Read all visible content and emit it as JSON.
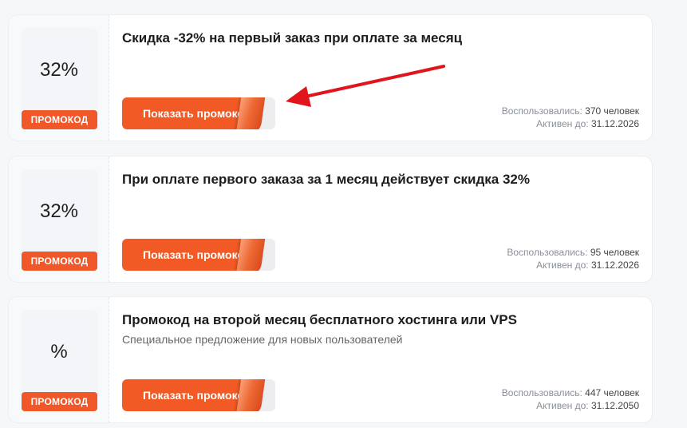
{
  "promos": [
    {
      "discount": "32%",
      "badge": "ПРОМОКОД",
      "title": "Скидка -32% на первый заказ при оплате за месяц",
      "subtitle": "",
      "button_label": "Показать промокод",
      "used_label": "Воспользовались:",
      "used_value": "370 человек",
      "active_label": "Активен до:",
      "active_value": "31.12.2026"
    },
    {
      "discount": "32%",
      "badge": "ПРОМОКОД",
      "title": "При оплате первого заказа за 1 месяц действует скидка 32%",
      "subtitle": "",
      "button_label": "Показать промокод",
      "used_label": "Воспользовались:",
      "used_value": "95 человек",
      "active_label": "Активен до:",
      "active_value": "31.12.2026"
    },
    {
      "discount": "%",
      "badge": "ПРОМОКОД",
      "title": "Промокод на второй месяц бесплатного хостинга или VPS",
      "subtitle": "Специальное предложение для новых пользователей",
      "button_label": "Показать промокод",
      "used_label": "Воспользовались:",
      "used_value": "447 человек",
      "active_label": "Активен до:",
      "active_value": "31.12.2050"
    }
  ],
  "colors": {
    "accent": "#f15a24",
    "badge": "#f0582a",
    "arrow": "#e0161c"
  }
}
